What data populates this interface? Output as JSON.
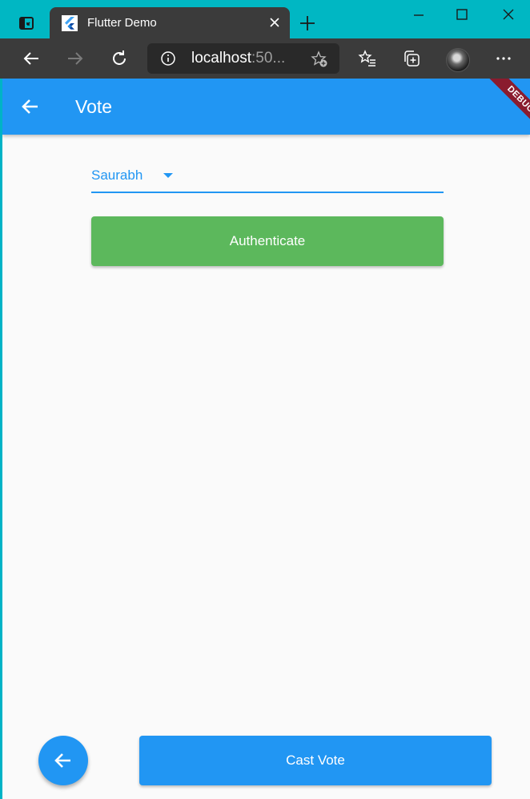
{
  "browser": {
    "tab_title": "Flutter Demo",
    "url_host": "localhost",
    "url_rest": ":50..."
  },
  "app": {
    "title": "Vote",
    "debug_label": "DEBUG",
    "dropdown": {
      "selected": "Saurabh"
    },
    "authenticate_label": "Authenticate",
    "cast_vote_label": "Cast Vote"
  },
  "colors": {
    "primary": "#2196f3",
    "authenticate": "#5cb85c",
    "debug_ribbon": "#8a1c2e",
    "titlebar": "#00b7c3",
    "toolbar": "#3b3b3b"
  },
  "icons": {
    "tab_actions": "tab-actions-icon",
    "favicon": "flutter-logo-icon",
    "tab_close": "close-icon",
    "new_tab": "plus-icon",
    "minimize": "minimize-icon",
    "maximize": "maximize-icon",
    "window_close": "close-icon",
    "back": "arrow-left-icon",
    "forward": "arrow-right-icon",
    "refresh": "refresh-icon",
    "site_info": "info-icon",
    "add_favorite": "star-plus-icon",
    "favorites": "favorites-list-icon",
    "collections": "collections-icon",
    "more": "more-horizontal-icon",
    "app_back": "arrow-back-icon",
    "dropdown_caret": "caret-down-icon",
    "fab_back": "arrow-back-icon"
  }
}
